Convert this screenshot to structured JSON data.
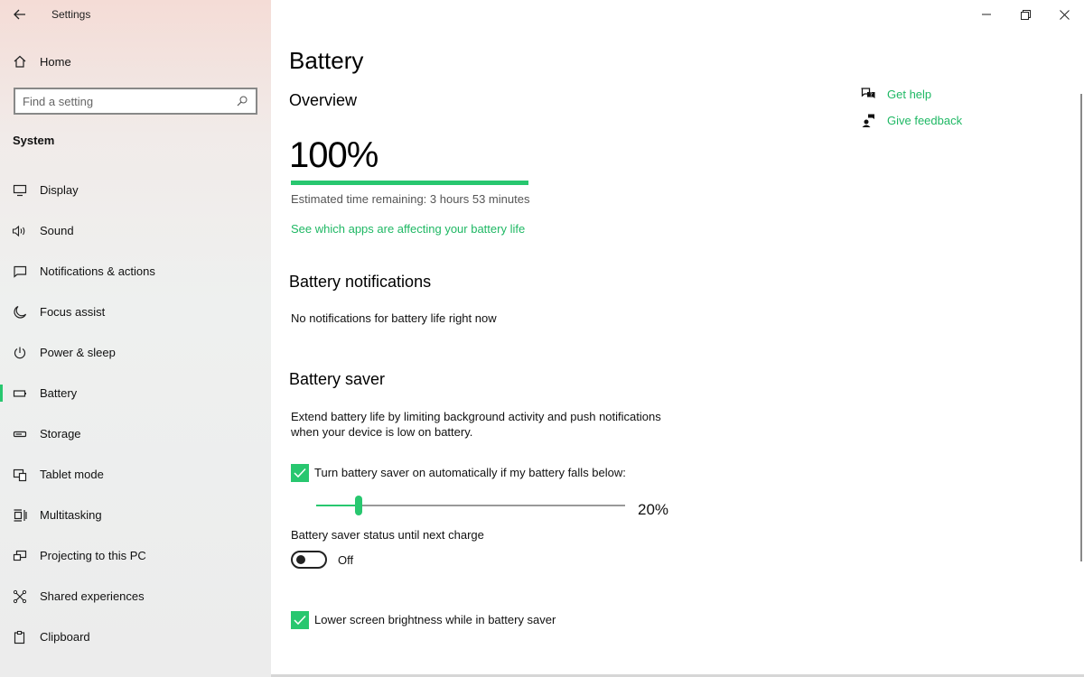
{
  "window": {
    "app_title": "Settings"
  },
  "sidebar": {
    "home_label": "Home",
    "search_placeholder": "Find a setting",
    "section_title": "System",
    "items": [
      {
        "label": "Display",
        "icon": "monitor-icon"
      },
      {
        "label": "Sound",
        "icon": "speaker-icon"
      },
      {
        "label": "Notifications & actions",
        "icon": "notification-icon"
      },
      {
        "label": "Focus assist",
        "icon": "moon-icon"
      },
      {
        "label": "Power & sleep",
        "icon": "power-icon"
      },
      {
        "label": "Battery",
        "icon": "battery-icon",
        "active": true
      },
      {
        "label": "Storage",
        "icon": "storage-icon"
      },
      {
        "label": "Tablet mode",
        "icon": "tablet-icon"
      },
      {
        "label": "Multitasking",
        "icon": "multitasking-icon"
      },
      {
        "label": "Projecting to this PC",
        "icon": "projecting-icon"
      },
      {
        "label": "Shared experiences",
        "icon": "shared-icon"
      },
      {
        "label": "Clipboard",
        "icon": "clipboard-icon"
      }
    ]
  },
  "main": {
    "page_title": "Battery",
    "overview": {
      "heading": "Overview",
      "percent": "100%",
      "percent_value": 100,
      "estimated": "Estimated time remaining: 3 hours 53 minutes",
      "apps_link": "See which apps are affecting your battery life"
    },
    "notifications": {
      "heading": "Battery notifications",
      "text": "No notifications for battery life right now"
    },
    "saver": {
      "heading": "Battery saver",
      "description_line1": "Extend battery life by limiting background activity and push notifications",
      "description_line2": "when your device is low on battery.",
      "auto_on_label": "Turn battery saver on automatically if my battery falls below:",
      "auto_on_checked": true,
      "threshold_value": "20%",
      "threshold_fraction": 0.2,
      "status_label": "Battery saver status until next charge",
      "toggle_state": "Off",
      "brightness_label": "Lower screen brightness while in battery saver",
      "brightness_checked": true
    },
    "help": {
      "get_help": "Get help",
      "give_feedback": "Give feedback"
    }
  },
  "colors": {
    "accent": "#28c76f",
    "link": "#1fb864"
  }
}
